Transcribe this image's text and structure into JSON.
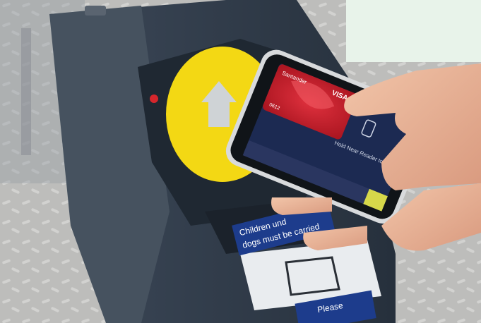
{
  "photo": {
    "subject": "contactless payment at ticket barrier",
    "phone_screen": {
      "bank_name": "Santander",
      "card_network": "VISA",
      "card_number_fragment": "0612",
      "prompt": "Hold Near Reader to Pay"
    },
    "signs": {
      "sticker_line_1": "Children und",
      "sticker_line_2": "dogs must be carried",
      "bottom_panel": "Please"
    }
  },
  "colors": {
    "reader_yellow": "#f3d814",
    "gate_body": "#2f3a48",
    "card_red": "#d42431",
    "sticker_blue": "#1d3c8c",
    "corner_overlay": "#e8f3ea"
  }
}
